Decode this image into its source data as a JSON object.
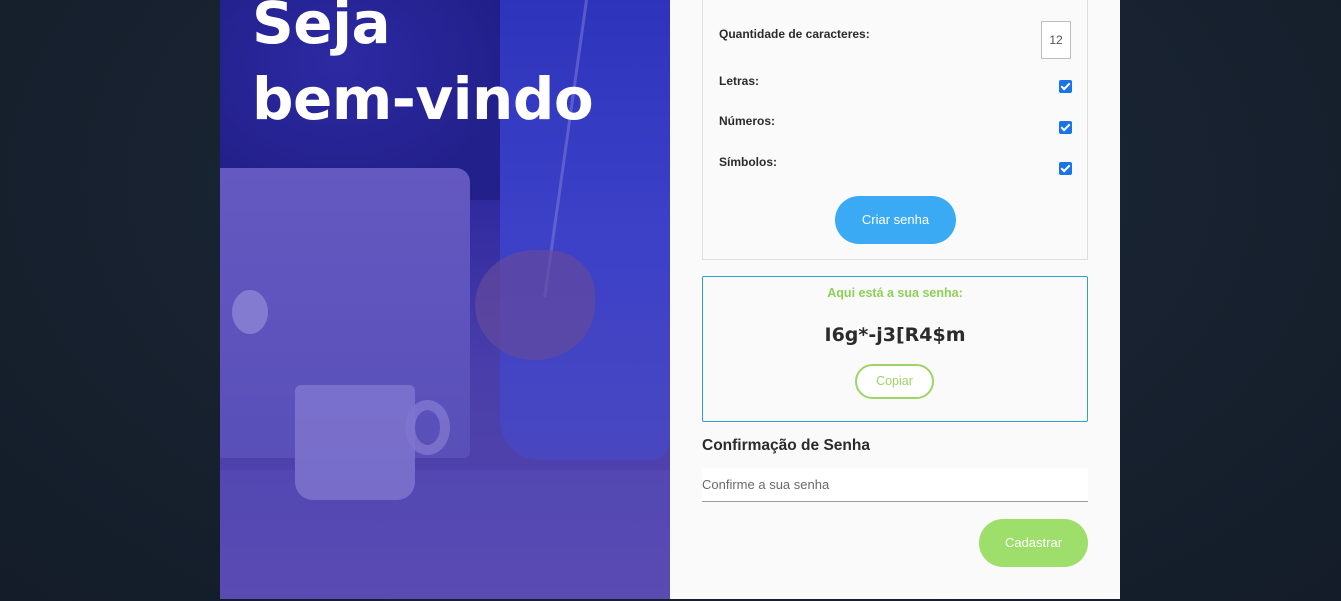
{
  "hero": {
    "title_line1": "Seja",
    "title_line2": "bem-vindo"
  },
  "generator": {
    "length_label": "Quantidade de caracteres:",
    "length_value": "12",
    "letters_label": "Letras:",
    "letters_checked": true,
    "numbers_label": "Números:",
    "numbers_checked": true,
    "symbols_label": "Símbolos:",
    "symbols_checked": true,
    "create_button": "Criar senha"
  },
  "result": {
    "title": "Aqui está a sua senha:",
    "password": "I6g*-j3[R4$m",
    "copy_button": "Copiar"
  },
  "confirm": {
    "title": "Confirmação de Senha",
    "placeholder": "Confirme a sua senha",
    "value": ""
  },
  "register_button": "Cadastrar",
  "colors": {
    "background": "#17212f",
    "hero_overlay": "#2a2596",
    "primary_blue": "#3aaaf5",
    "accent_green": "#9ede6a",
    "checkbox": "#1a73e8",
    "result_border": "#2e9fd8"
  }
}
